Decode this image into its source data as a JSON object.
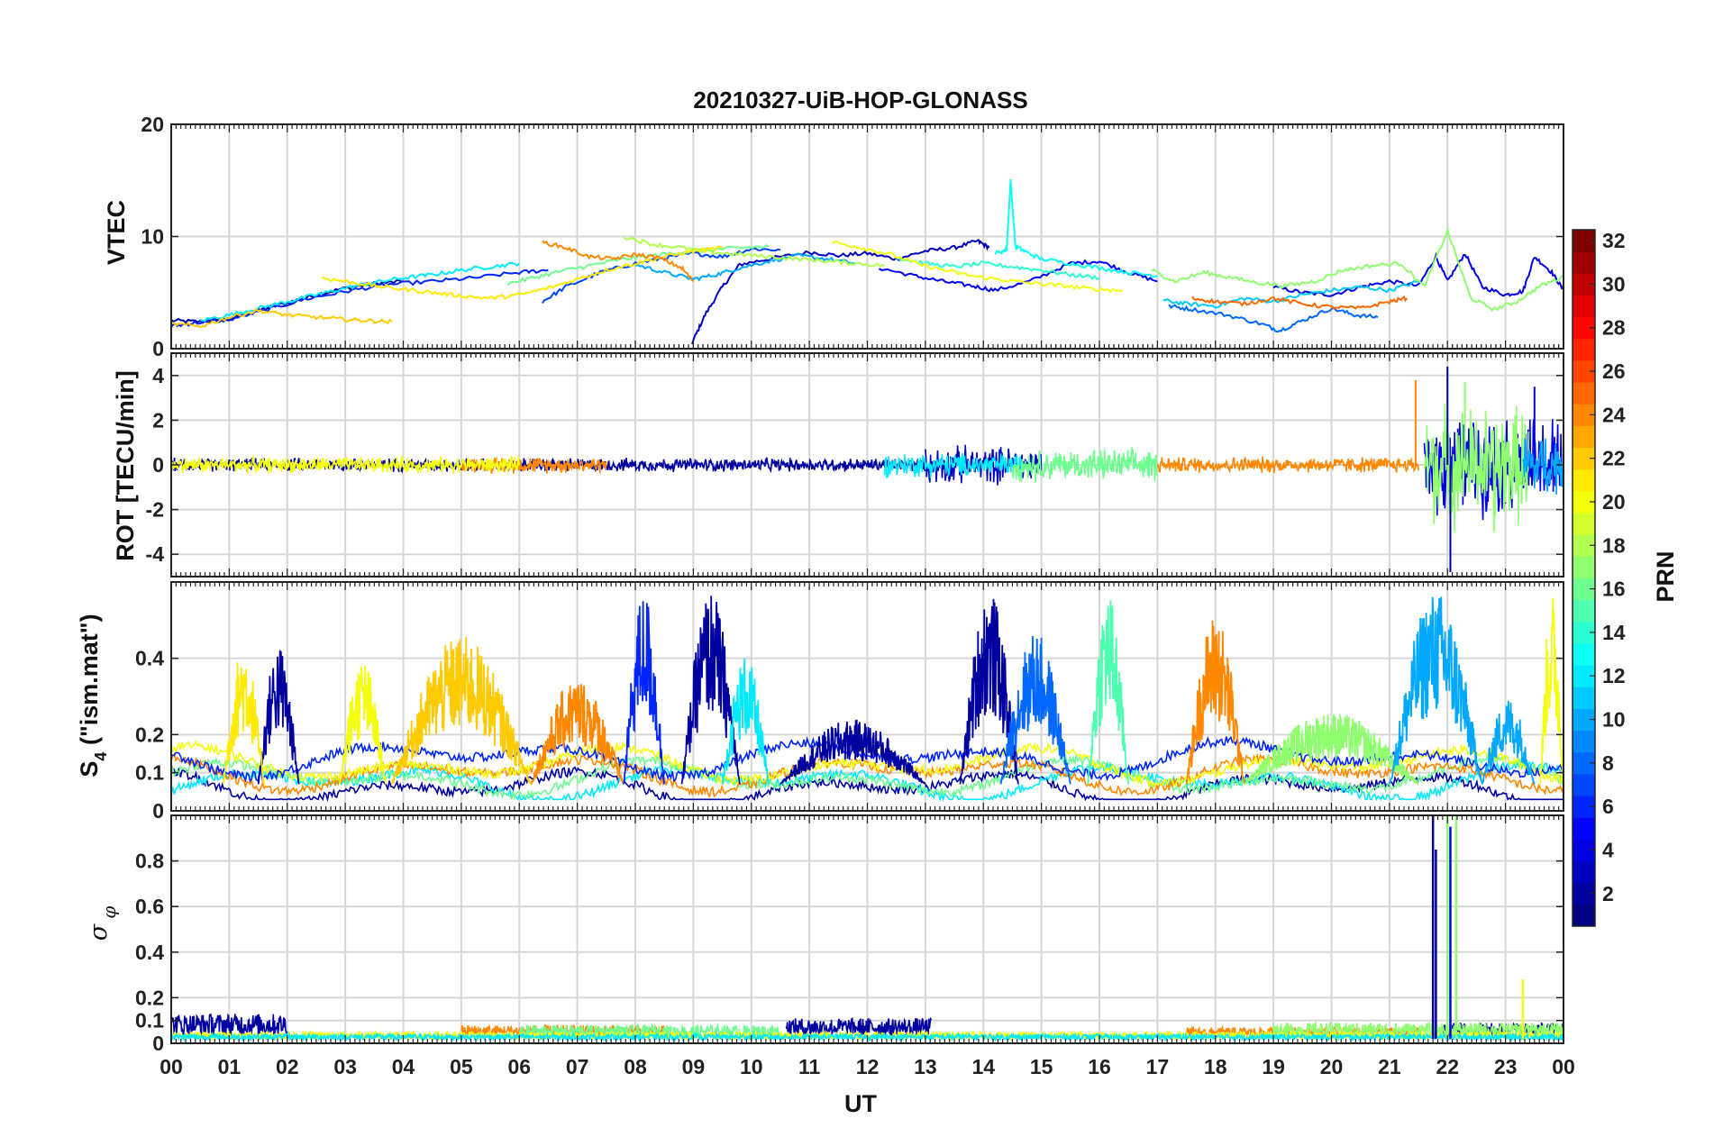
{
  "chart_data": [
    {
      "type": "line",
      "title": "20210327-UiB-HOP-GLONASS",
      "ylabel": "VTEC",
      "xlim": [
        0,
        24
      ],
      "ylim": [
        0,
        20
      ],
      "yticks": [
        0,
        10,
        20
      ],
      "grid": true,
      "color_by": "PRN",
      "series": [
        {
          "prn": 2,
          "x": [
            0.0,
            0.5,
            1.0,
            1.5,
            2.0,
            2.5,
            3.0,
            3.5,
            4.0
          ],
          "y": [
            2.5,
            2.4,
            2.6,
            3.4,
            4.1,
            4.8,
            5.4,
            5.8,
            6.0
          ]
        },
        {
          "prn": 3,
          "x": [
            8.98,
            9.2,
            9.5,
            9.8,
            10.3,
            11.0,
            11.5,
            12.0,
            12.5,
            13.0,
            13.5,
            13.9,
            14.1
          ],
          "y": [
            0.5,
            3.0,
            5.5,
            7.5,
            8.0,
            8.6,
            8.3,
            8.5,
            8.0,
            8.7,
            9.0,
            9.6,
            9.0
          ]
        },
        {
          "prn": 4,
          "x": [
            19.0,
            19.5,
            20.0,
            20.5,
            21.0,
            21.5,
            21.8,
            22.0,
            22.3,
            22.6,
            23.0,
            23.3,
            23.5,
            23.8,
            24.0
          ],
          "y": [
            5.5,
            5.0,
            4.8,
            5.5,
            6.0,
            5.6,
            8.2,
            6.0,
            8.5,
            5.5,
            4.8,
            5.1,
            8.2,
            6.8,
            5.2
          ]
        },
        {
          "prn": 5,
          "x": [
            12.2,
            12.8,
            13.3,
            13.8,
            14.2,
            14.8,
            15.5,
            16.0,
            16.5,
            17.0
          ],
          "y": [
            7.2,
            6.5,
            6.0,
            5.6,
            5.2,
            6.0,
            7.6,
            7.8,
            6.8,
            6.0
          ]
        },
        {
          "prn": 6,
          "x": [
            0.0,
            0.4,
            1.0,
            1.6,
            2.3,
            3.0,
            3.7,
            4.5,
            5.2,
            6.0,
            6.5
          ],
          "y": [
            2.0,
            2.3,
            2.6,
            3.4,
            4.4,
            5.1,
            5.7,
            6.0,
            6.3,
            6.8,
            7.0
          ]
        },
        {
          "prn": 7,
          "x": [
            6.4,
            6.8,
            7.4,
            8.0,
            8.5,
            9.0,
            9.5,
            10.0,
            10.5
          ],
          "y": [
            4.2,
            5.5,
            6.8,
            7.6,
            8.1,
            8.5,
            8.2,
            8.9,
            8.8
          ]
        },
        {
          "prn": 8,
          "x": [
            17.2,
            17.6,
            18.2,
            18.8,
            19.1,
            19.5,
            20.0,
            20.4,
            20.8
          ],
          "y": [
            3.8,
            3.5,
            3.0,
            2.2,
            1.6,
            2.5,
            3.6,
            3.0,
            2.8
          ]
        },
        {
          "prn": 10,
          "x": [
            8.0,
            8.5,
            9.0,
            9.4,
            9.8,
            10.3,
            10.8,
            11.3,
            11.8
          ],
          "y": [
            7.5,
            6.8,
            6.2,
            6.6,
            7.2,
            7.8,
            8.3,
            8.0,
            7.6
          ]
        },
        {
          "prn": 11,
          "x": [
            17.1,
            17.5,
            18.0,
            18.5,
            19.0,
            19.5,
            20.0,
            20.5,
            21.0,
            21.5
          ],
          "y": [
            4.3,
            4.0,
            3.8,
            4.5,
            4.2,
            4.8,
            5.2,
            5.5,
            5.2,
            6.0
          ]
        },
        {
          "prn": 12,
          "x": [
            0.5,
            1.0,
            1.5,
            2.0,
            2.5,
            3.0,
            3.5,
            4.0,
            4.5,
            5.0,
            5.5,
            6.0
          ],
          "y": [
            2.5,
            3.0,
            3.6,
            4.2,
            4.8,
            5.4,
            5.9,
            6.3,
            6.6,
            7.0,
            7.3,
            7.6
          ]
        },
        {
          "prn": 13,
          "x": [
            14.2,
            14.4,
            14.47,
            14.55,
            14.7,
            15.0,
            15.5,
            16.0,
            16.5,
            17.0
          ],
          "y": [
            8.5,
            8.8,
            15.0,
            9.2,
            8.7,
            8.0,
            7.6,
            7.2,
            6.8,
            6.5
          ]
        },
        {
          "prn": 14,
          "x": [
            12.5,
            13.0,
            13.5,
            14.0,
            14.5,
            15.0,
            15.5,
            16.0
          ],
          "y": [
            8.1,
            7.6,
            7.3,
            7.6,
            7.3,
            7.0,
            6.6,
            6.3
          ]
        },
        {
          "prn": 16,
          "x": [
            5.8,
            6.3,
            6.8,
            7.3,
            7.8,
            8.3,
            8.8,
            9.3,
            9.8,
            10.3
          ],
          "y": [
            5.8,
            6.4,
            7.0,
            7.5,
            8.0,
            8.3,
            8.6,
            8.8,
            9.0,
            9.1
          ]
        },
        {
          "prn": 17,
          "x": [
            16.9,
            17.3,
            17.8,
            18.2,
            18.7,
            19.2,
            19.7,
            20.2,
            20.7,
            21.2,
            21.6,
            22.0,
            22.4,
            22.8,
            23.2,
            23.6,
            24.0
          ],
          "y": [
            7.0,
            6.0,
            6.8,
            6.4,
            5.9,
            5.6,
            6.0,
            7.0,
            7.4,
            7.6,
            5.5,
            10.5,
            4.5,
            3.5,
            4.2,
            5.6,
            6.4
          ]
        },
        {
          "prn": 18,
          "x": [
            7.8,
            8.3,
            8.8,
            9.3,
            9.8,
            10.3,
            10.8,
            11.3,
            11.8,
            12.3
          ],
          "y": [
            10.0,
            9.3,
            9.0,
            8.6,
            8.4,
            8.2,
            8.0,
            7.8,
            7.6,
            7.4
          ]
        },
        {
          "prn": 20,
          "x": [
            11.4,
            11.9,
            12.4,
            12.9,
            13.4,
            13.9,
            14.4,
            14.9,
            15.4,
            15.9,
            16.4
          ],
          "y": [
            9.5,
            9.0,
            8.4,
            7.5,
            6.9,
            6.4,
            6.1,
            5.8,
            5.6,
            5.3,
            5.2
          ]
        },
        {
          "prn": 21,
          "x": [
            2.6,
            3.0,
            3.5,
            4.0,
            4.5,
            5.0,
            5.5,
            6.0,
            6.5,
            7.0,
            7.5,
            8.0,
            8.5,
            9.0,
            9.5
          ],
          "y": [
            6.3,
            6.0,
            5.6,
            5.3,
            5.0,
            4.7,
            4.5,
            4.8,
            5.4,
            6.2,
            7.0,
            7.6,
            8.2,
            8.7,
            9.0
          ]
        },
        {
          "prn": 22,
          "x": [
            0.0,
            0.5,
            1.0,
            1.5,
            2.0,
            2.5,
            3.0,
            3.4,
            3.8
          ],
          "y": [
            2.2,
            2.0,
            2.8,
            3.4,
            3.0,
            2.8,
            2.6,
            2.5,
            2.4
          ]
        },
        {
          "prn": 24,
          "x": [
            6.4,
            6.8,
            7.2,
            7.6,
            8.0,
            8.4,
            8.8,
            9.0
          ],
          "y": [
            9.5,
            9.0,
            8.2,
            8.0,
            8.4,
            8.1,
            7.2,
            6.0
          ]
        },
        {
          "prn": 25,
          "x": [
            17.6,
            18.0,
            18.5,
            19.0,
            19.5,
            20.0,
            20.5,
            21.0,
            21.3
          ],
          "y": [
            4.5,
            4.2,
            4.0,
            4.5,
            4.0,
            3.7,
            3.6,
            4.2,
            4.5
          ]
        }
      ]
    },
    {
      "type": "line",
      "ylabel": "ROT [TECU/min]",
      "xlim": [
        0,
        24
      ],
      "ylim": [
        -5,
        5
      ],
      "yticks": [
        -4,
        -2,
        0,
        2,
        4
      ],
      "grid": true,
      "color_by": "PRN",
      "segments": [
        {
          "prn": 2,
          "x": [
            0,
            13
          ],
          "amp": 0.25
        },
        {
          "prn": 3,
          "x": [
            13,
            15
          ],
          "amp": 0.7
        },
        {
          "prn": 12,
          "x": [
            12.3,
            14.7
          ],
          "amp": 0.45
        },
        {
          "prn": 16,
          "x": [
            14.5,
            17
          ],
          "amp": 0.6
        },
        {
          "prn": 24,
          "x": [
            5,
            7.5
          ],
          "amp": 0.3
        },
        {
          "prn": 24,
          "x": [
            17,
            21.5
          ],
          "amp": 0.3
        },
        {
          "prn": 20,
          "x": [
            0,
            6
          ],
          "amp": 0.3
        },
        {
          "prn": 4,
          "x": [
            21.6,
            24
          ],
          "amp": 1.8
        },
        {
          "prn": 17,
          "x": [
            21.6,
            23.4
          ],
          "amp": 2.2
        },
        {
          "prn": 10,
          "x": [
            23.3,
            24
          ],
          "amp": 1.2
        }
      ],
      "spikes": [
        {
          "prn": 2,
          "x": 22.0,
          "y": 4.4
        },
        {
          "prn": 2,
          "x": 22.05,
          "y": -4.8
        },
        {
          "prn": 24,
          "x": 21.45,
          "y": 3.8
        },
        {
          "prn": 17,
          "x": 22.3,
          "y": 3.7
        },
        {
          "prn": 17,
          "x": 22.8,
          "y": -3.0
        },
        {
          "prn": 4,
          "x": 23.5,
          "y": 3.5
        }
      ]
    },
    {
      "type": "line",
      "ylabel": "S_4 (\"ism.mat\")",
      "xlim": [
        0,
        24
      ],
      "ylim": [
        0,
        0.6
      ],
      "yticks": [
        0,
        0.1,
        0.2,
        0.4
      ],
      "yticklabels": [
        "0",
        "0.1",
        "0.2",
        "0.4"
      ],
      "grid": true,
      "color_by": "PRN",
      "bursts": [
        {
          "prn": 2,
          "x": [
            1.5,
            2.2
          ],
          "peak": 0.44
        },
        {
          "prn": 21,
          "x": [
            0.9,
            1.6
          ],
          "peak": 0.44
        },
        {
          "prn": 20,
          "x": [
            2.9,
            3.7
          ],
          "peak": 0.4
        },
        {
          "prn": 22,
          "x": [
            3.8,
            6.2
          ],
          "peak": 0.46
        },
        {
          "prn": 24,
          "x": [
            6.2,
            7.8
          ],
          "peak": 0.35
        },
        {
          "prn": 6,
          "x": [
            7.8,
            8.5
          ],
          "peak": 0.58
        },
        {
          "prn": 2,
          "x": [
            8.8,
            9.8
          ],
          "peak": 0.58
        },
        {
          "prn": 12,
          "x": [
            9.5,
            10.3
          ],
          "peak": 0.41
        },
        {
          "prn": 2,
          "x": [
            10.5,
            13.0
          ],
          "peak": 0.24
        },
        {
          "prn": 2,
          "x": [
            13.6,
            14.6
          ],
          "peak": 0.58
        },
        {
          "prn": 8,
          "x": [
            14.3,
            15.5
          ],
          "peak": 0.47
        },
        {
          "prn": 15,
          "x": [
            15.8,
            16.5
          ],
          "peak": 0.58
        },
        {
          "prn": 24,
          "x": [
            17.5,
            18.5
          ],
          "peak": 0.52
        },
        {
          "prn": 17,
          "x": [
            18.5,
            21.5
          ],
          "peak": 0.26
        },
        {
          "prn": 10,
          "x": [
            21.0,
            22.6
          ],
          "peak": 0.58
        },
        {
          "prn": 10,
          "x": [
            22.6,
            23.5
          ],
          "peak": 0.3
        },
        {
          "prn": 20,
          "x": [
            23.6,
            24.0
          ],
          "peak": 0.58
        }
      ],
      "baselines": [
        {
          "prn": 2,
          "level": 0.06
        },
        {
          "prn": 12,
          "level": 0.075
        },
        {
          "prn": 16,
          "level": 0.085
        },
        {
          "prn": 24,
          "level": 0.1
        },
        {
          "prn": 20,
          "level": 0.12
        },
        {
          "prn": 6,
          "level": 0.14
        }
      ]
    },
    {
      "type": "line",
      "ylabel": "σ_φ",
      "xlabel": "UT",
      "xlim": [
        0,
        24
      ],
      "ylim": [
        0,
        1
      ],
      "yticks": [
        0,
        0.1,
        0.2,
        0.4,
        0.6,
        0.8
      ],
      "yticklabels": [
        "0",
        "0.1",
        "0.2",
        "0.4",
        "0.6",
        "0.8"
      ],
      "xticklabels": [
        "00",
        "01",
        "02",
        "03",
        "04",
        "05",
        "06",
        "07",
        "08",
        "09",
        "10",
        "11",
        "12",
        "13",
        "14",
        "15",
        "16",
        "17",
        "18",
        "19",
        "20",
        "21",
        "22",
        "23",
        "00"
      ],
      "grid": true,
      "color_by": "PRN",
      "segments": [
        {
          "prn": 2,
          "x": [
            0,
            2.0
          ],
          "amp": 0.12
        },
        {
          "prn": 2,
          "x": [
            10.6,
            13.1
          ],
          "amp": 0.1
        },
        {
          "prn": 2,
          "x": [
            21.9,
            24
          ],
          "amp": 0.08
        },
        {
          "prn": 24,
          "x": [
            5.0,
            8.5
          ],
          "amp": 0.07
        },
        {
          "prn": 24,
          "x": [
            17.5,
            21.5
          ],
          "amp": 0.06
        },
        {
          "prn": 16,
          "x": [
            6.0,
            10.5
          ],
          "amp": 0.07
        },
        {
          "prn": 17,
          "x": [
            19.0,
            24
          ],
          "amp": 0.08
        },
        {
          "prn": 20,
          "x": [
            0,
            24
          ],
          "amp": 0.04
        },
        {
          "prn": 12,
          "x": [
            0,
            24
          ],
          "amp": 0.03
        }
      ],
      "spikes": [
        {
          "prn": 2,
          "x": 21.75,
          "y": 1.0
        },
        {
          "prn": 2,
          "x": 21.8,
          "y": 0.85
        },
        {
          "prn": 17,
          "x": 22.0,
          "y": 1.0
        },
        {
          "prn": 4,
          "x": 22.05,
          "y": 0.95
        },
        {
          "prn": 17,
          "x": 22.15,
          "y": 1.0
        },
        {
          "prn": 20,
          "x": 23.3,
          "y": 0.28
        }
      ]
    }
  ],
  "colorbar": {
    "label": "PRN",
    "min": 1,
    "max": 32,
    "ticks": [
      2,
      4,
      6,
      8,
      10,
      12,
      14,
      16,
      18,
      20,
      22,
      24,
      26,
      28,
      30,
      32
    ],
    "colormap": "jet"
  }
}
